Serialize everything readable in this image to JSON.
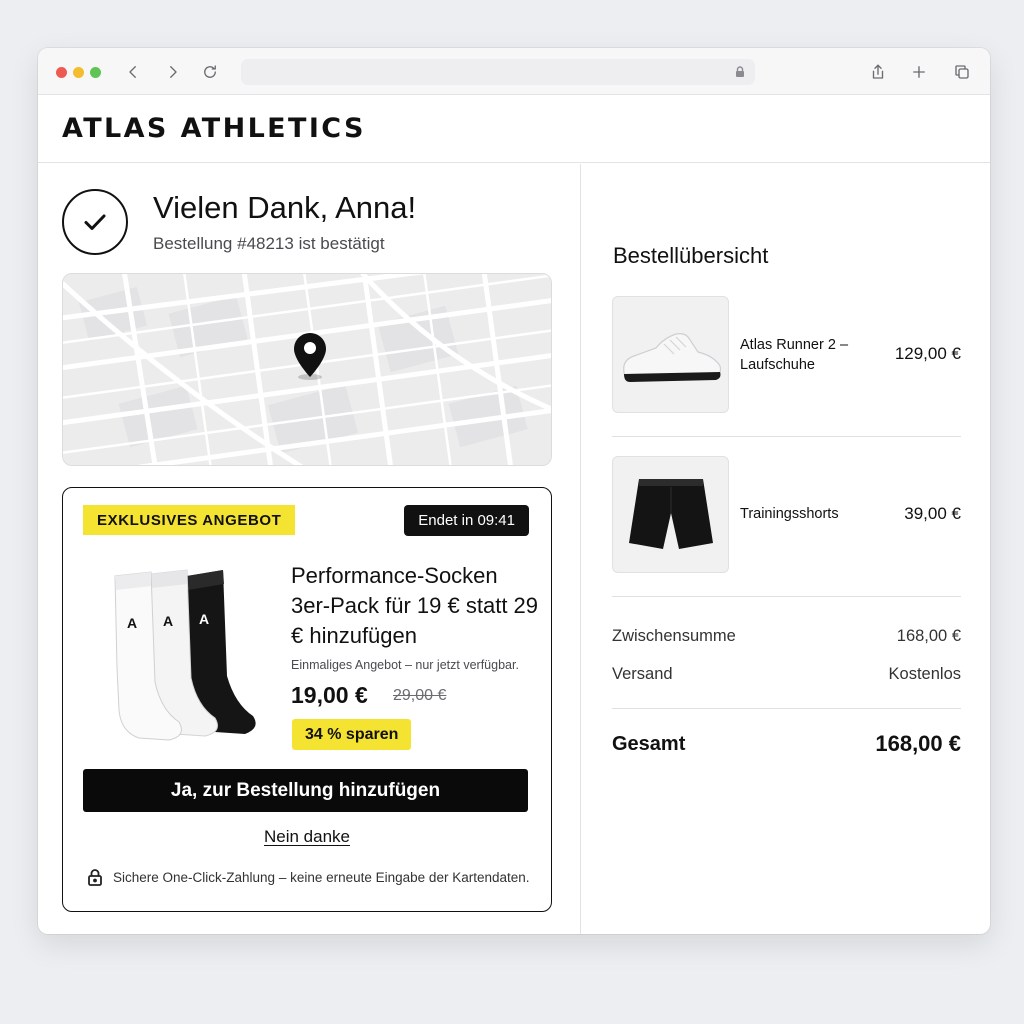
{
  "browser": {
    "nav_icons": [
      "back-icon",
      "forward-icon",
      "reload-icon"
    ],
    "action_icons": [
      "share-icon",
      "new-tab-icon",
      "tabs-icon"
    ],
    "url_icon": "lock-icon"
  },
  "site": {
    "logo": "ATLAS ATHLETICS"
  },
  "confirmation": {
    "title": "Vielen Dank, Anna!",
    "subtitle": "Bestellung #48213 ist bestätigt",
    "icon": "check-icon"
  },
  "map": {
    "icon": "location-pin-icon"
  },
  "offer": {
    "badge": "EXKLUSIVES ANGEBOT",
    "timer": "Endet in 09:41",
    "title": "Performance-Socken 3er-Pack für 19 € statt 29 € hinzufügen",
    "note": "Einmaliges Angebot – nur jetzt verfügbar.",
    "price": "19,00 €",
    "old_price": "29,00 €",
    "savings": "34 % sparen",
    "cta": "Ja, zur Bestellung hinzufügen",
    "decline": "Nein danke",
    "secure_text": "Sichere One-Click-Zahlung – keine erneute Eingabe der Kartendaten.",
    "sock_letter": "A"
  },
  "summary": {
    "title": "Bestellübersicht",
    "items": [
      {
        "name": "Atlas Runner 2 – Laufschuhe",
        "price": "129,00 €"
      },
      {
        "name": "Trainingsshorts",
        "price": "39,00 €"
      }
    ],
    "subtotal_label": "Zwischensumme",
    "subtotal_value": "168,00 €",
    "shipping_label": "Versand",
    "shipping_value": "Kostenlos",
    "total_label": "Gesamt",
    "total_value": "168,00 €"
  },
  "colors": {
    "accent_yellow": "#f5e332",
    "dark": "#0a0a0a"
  }
}
